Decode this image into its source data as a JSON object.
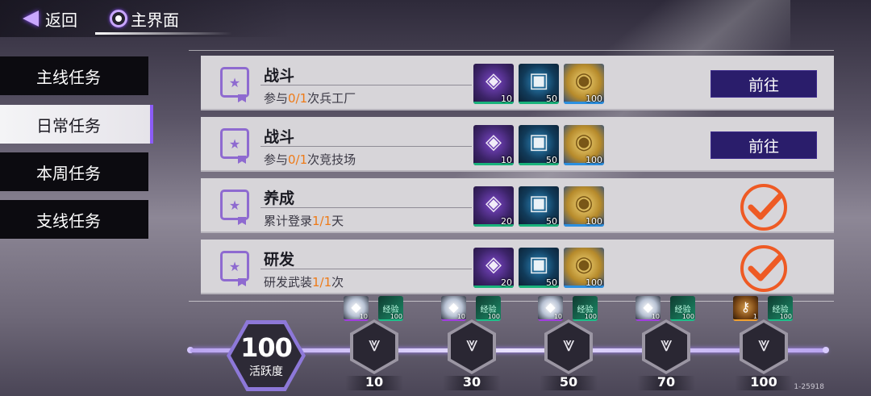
{
  "topbar": {
    "back_label": "返回",
    "home_label": "主界面"
  },
  "sidebar": {
    "items": [
      {
        "label": "主线任务",
        "active": false
      },
      {
        "label": "日常任务",
        "active": true
      },
      {
        "label": "本周任务",
        "active": false
      },
      {
        "label": "支线任务",
        "active": false
      }
    ]
  },
  "tasks": [
    {
      "title": "战斗",
      "desc_prefix": "参与",
      "progress": "0/1",
      "desc_suffix": "次兵工厂",
      "rewards": [
        {
          "type": "purple-chip",
          "qty": "10"
        },
        {
          "type": "blue-chip",
          "qty": "50"
        },
        {
          "type": "gold-coin",
          "qty": "100"
        }
      ],
      "action": "前往",
      "completed": false
    },
    {
      "title": "战斗",
      "desc_prefix": "参与",
      "progress": "0/1",
      "desc_suffix": "次竞技场",
      "rewards": [
        {
          "type": "purple-chip",
          "qty": "10"
        },
        {
          "type": "blue-chip",
          "qty": "50"
        },
        {
          "type": "gold-coin",
          "qty": "100"
        }
      ],
      "action": "前往",
      "completed": false
    },
    {
      "title": "养成",
      "desc_prefix": "累计登录",
      "progress": "1/1",
      "desc_suffix": "天",
      "rewards": [
        {
          "type": "purple-chip",
          "qty": "20"
        },
        {
          "type": "blue-chip",
          "qty": "50"
        },
        {
          "type": "gold-coin",
          "qty": "100"
        }
      ],
      "action": "",
      "completed": true
    },
    {
      "title": "研发",
      "desc_prefix": "研发武装",
      "progress": "1/1",
      "desc_suffix": "次",
      "rewards": [
        {
          "type": "purple-chip",
          "qty": "20"
        },
        {
          "type": "blue-chip",
          "qty": "50"
        },
        {
          "type": "gold-coin",
          "qty": "100"
        }
      ],
      "action": "",
      "completed": true
    }
  ],
  "activity": {
    "value": "100",
    "label": "活跃度",
    "milestones": [
      {
        "value": "10",
        "rewards": [
          {
            "type": "diamond",
            "qty": "10"
          },
          {
            "type": "ticket",
            "qty": "100"
          }
        ]
      },
      {
        "value": "30",
        "rewards": [
          {
            "type": "diamond",
            "qty": "10"
          },
          {
            "type": "ticket",
            "qty": "100"
          }
        ]
      },
      {
        "value": "50",
        "rewards": [
          {
            "type": "diamond",
            "qty": "10"
          },
          {
            "type": "ticket",
            "qty": "100"
          }
        ]
      },
      {
        "value": "70",
        "rewards": [
          {
            "type": "diamond",
            "qty": "10"
          },
          {
            "type": "ticket",
            "qty": "100"
          }
        ]
      },
      {
        "value": "100",
        "rewards": [
          {
            "type": "key",
            "qty": "1"
          },
          {
            "type": "ticket",
            "qty": "100"
          }
        ]
      }
    ]
  },
  "ticket_text": "经验",
  "version": "1-25918",
  "colors": {
    "accent": "#8b5cf6",
    "highlight": "#ee7a17",
    "goto_button": "#2a1d6b",
    "check": "#ee5a24"
  }
}
